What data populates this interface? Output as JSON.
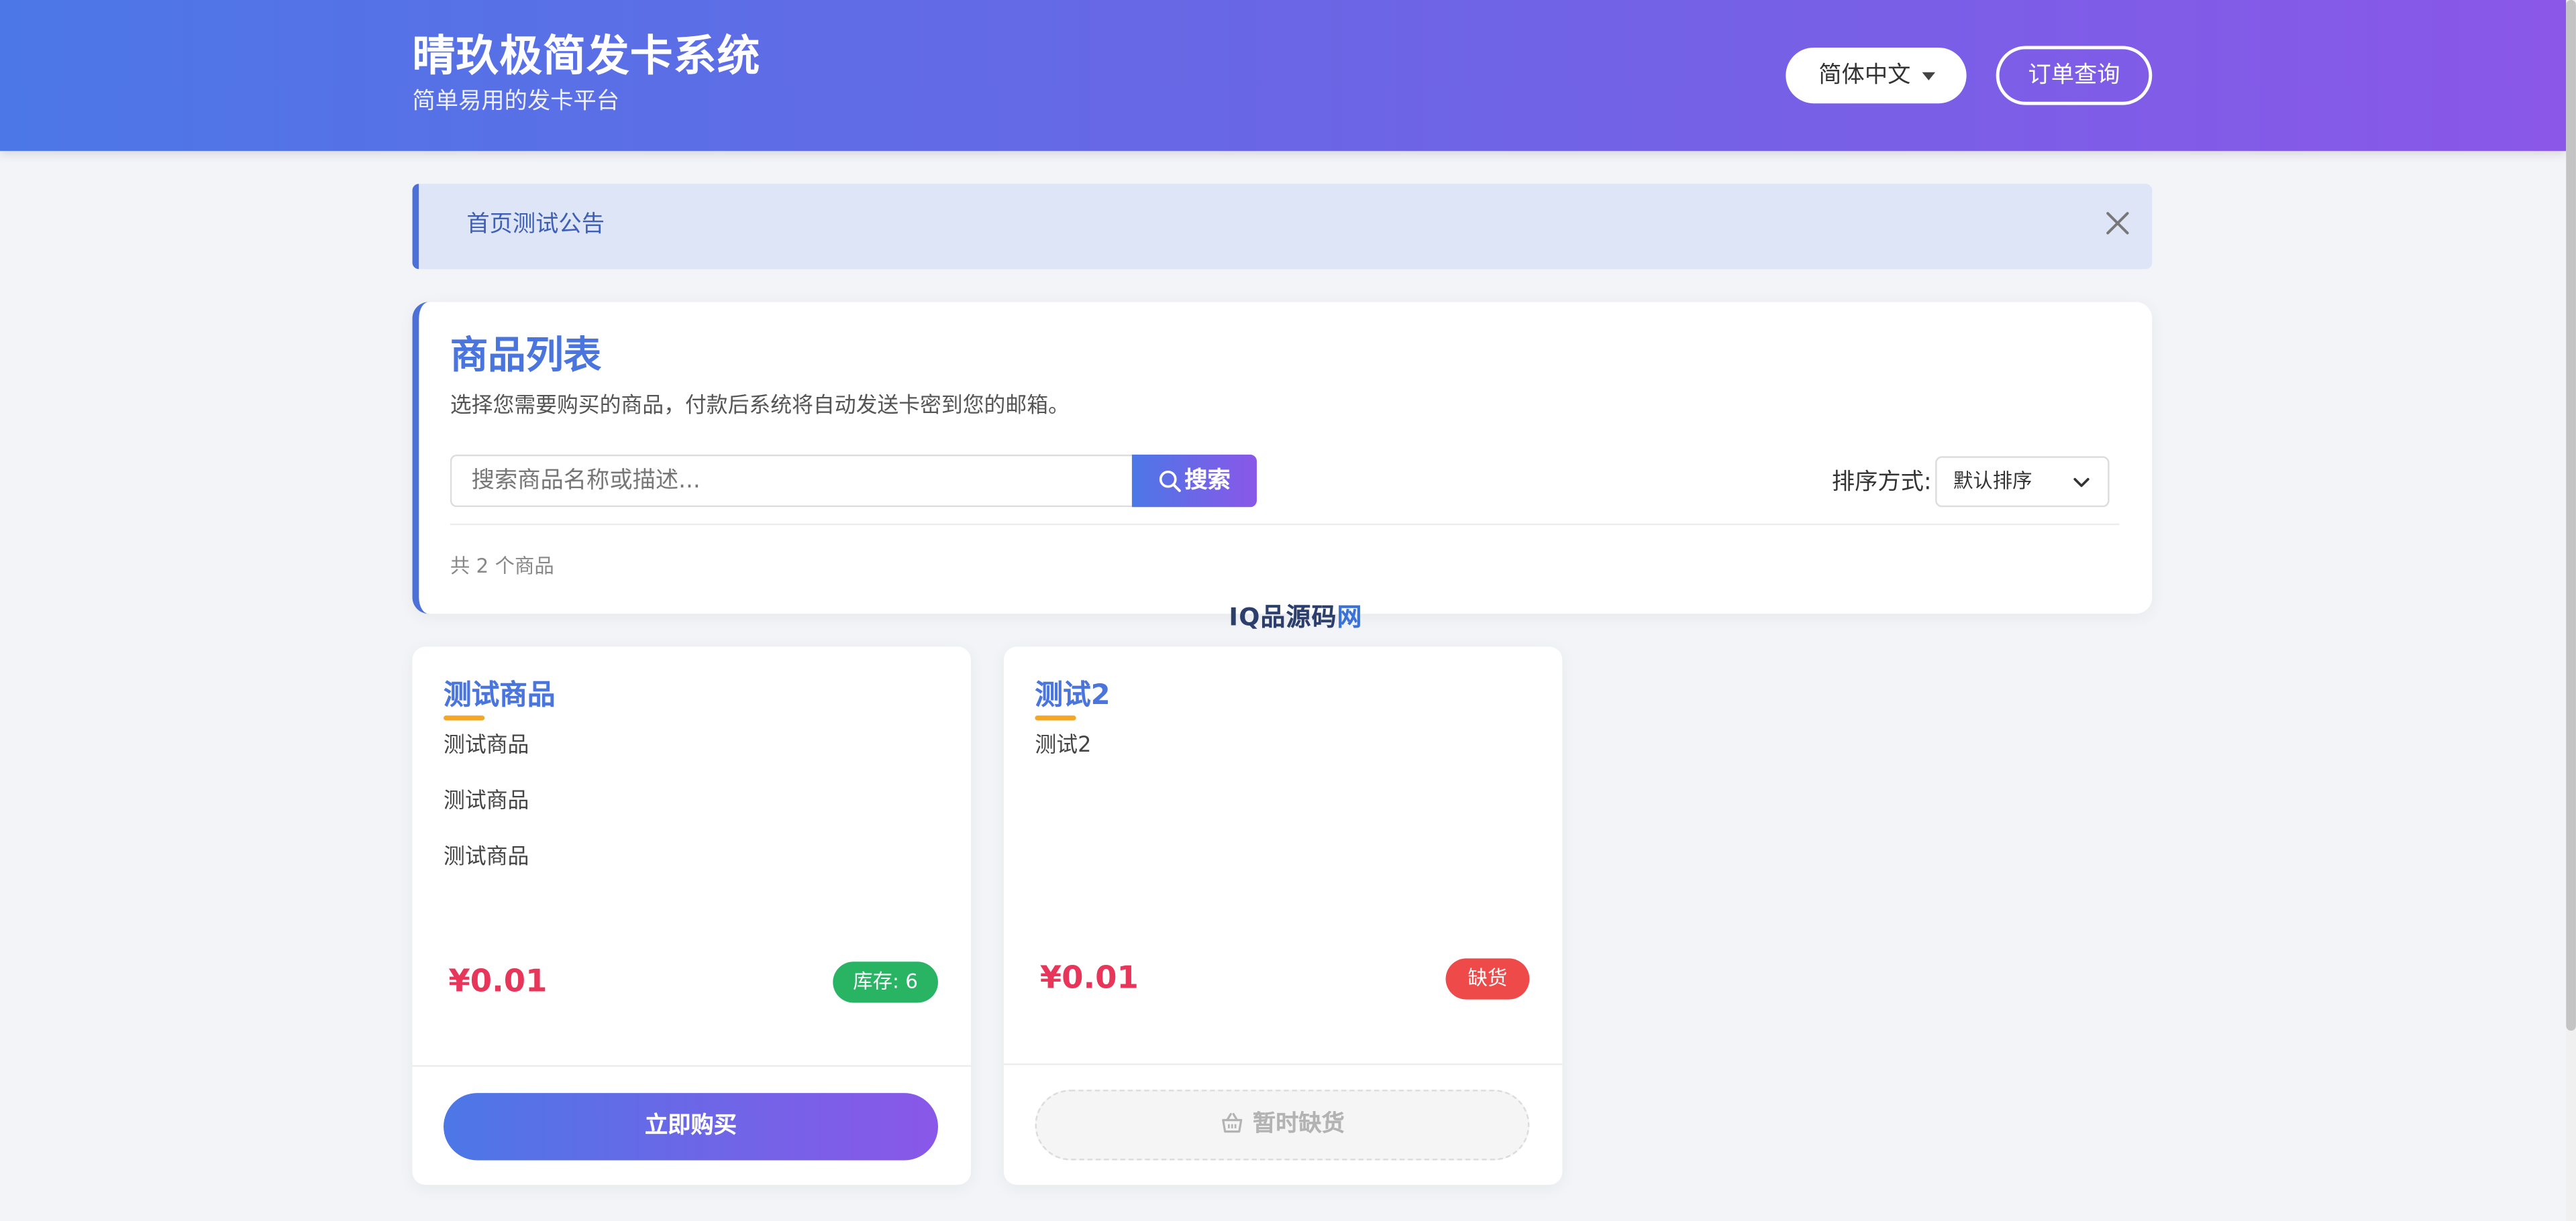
{
  "header": {
    "title": "晴玖极简发卡系统",
    "subtitle": "简单易用的发卡平台",
    "language": "简体中文",
    "order_query": "订单查询"
  },
  "notice": {
    "text": "首页测试公告"
  },
  "products_panel": {
    "title": "商品列表",
    "description": "选择您需要购买的商品，付款后系统将自动发送卡密到您的邮箱。",
    "search_placeholder": "搜索商品名称或描述...",
    "search_button": "搜索",
    "sort_label": "排序方式:",
    "sort_value": "默认排序",
    "count_text": "共 2 个商品"
  },
  "watermark": {
    "prefix": "IQ品",
    "main": "源码",
    "suffix": "网"
  },
  "products": [
    {
      "name": "测试商品",
      "description_lines": [
        "测试商品",
        "测试商品",
        "测试商品"
      ],
      "price": "¥0.01",
      "stock_label": "库存: 6",
      "stock_status": "in_stock",
      "action_label": "立即购买"
    },
    {
      "name": "测试2",
      "description_lines": [
        "测试2"
      ],
      "price": "¥0.01",
      "stock_label": "缺货",
      "stock_status": "out_of_stock",
      "action_label": "暂时缺货"
    }
  ],
  "colors": {
    "brand_gradient_start": "#4c77e6",
    "brand_gradient_end": "#8a57e8",
    "price": "#e8355a",
    "in_stock": "#28b463",
    "out_of_stock": "#ef4a4a",
    "title_accent": "#4a75dd",
    "underline_accent": "#f5a623"
  }
}
